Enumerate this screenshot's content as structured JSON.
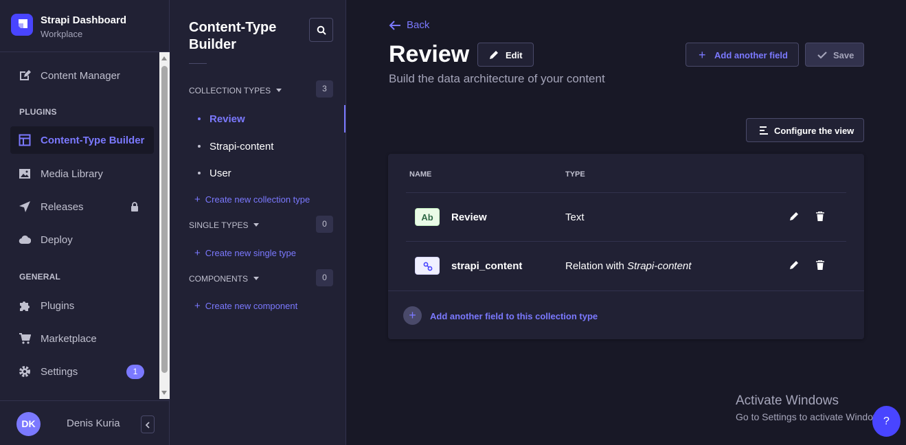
{
  "brand": {
    "title": "Strapi Dashboard",
    "subtitle": "Workplace"
  },
  "mainnav": {
    "content_manager": "Content Manager",
    "plugins_section": "PLUGINS",
    "content_type_builder": "Content-Type Builder",
    "media_library": "Media Library",
    "releases": "Releases",
    "deploy": "Deploy",
    "general_section": "GENERAL",
    "plugins": "Plugins",
    "marketplace": "Marketplace",
    "settings": "Settings",
    "settings_badge": "1"
  },
  "user": {
    "initials": "DK",
    "name": "Denis Kuria"
  },
  "subnav": {
    "title": "Content-Type Builder",
    "collection_types": {
      "label": "COLLECTION TYPES",
      "count": "3",
      "items": [
        "Review",
        "Strapi-content",
        "User"
      ],
      "create": "Create new collection type"
    },
    "single_types": {
      "label": "SINGLE TYPES",
      "count": "0",
      "create": "Create new single type"
    },
    "components": {
      "label": "COMPONENTS",
      "count": "0",
      "create": "Create new component"
    }
  },
  "main": {
    "back": "Back",
    "title": "Review",
    "edit": "Edit",
    "subtitle": "Build the data architecture of your content",
    "add_another_field": "Add another field",
    "save": "Save",
    "configure_view": "Configure the view",
    "table": {
      "col_name": "NAME",
      "col_type": "TYPE",
      "rows": [
        {
          "icon": "Ab",
          "name": "Review",
          "type": "Text"
        },
        {
          "icon": "relation-icon",
          "name": "strapi_content",
          "type_prefix": "Relation with ",
          "type_target": "Strapi-content"
        }
      ]
    },
    "add_field_footer": "Add another field to this collection type"
  },
  "overlay": {
    "win_line1": "Activate Windows",
    "win_line2": "Go to Settings to activate Windows.",
    "help": "?"
  },
  "colors": {
    "accent": "#7b79ff",
    "primary": "#4945ff",
    "background": "#181826",
    "panel": "#212134"
  }
}
